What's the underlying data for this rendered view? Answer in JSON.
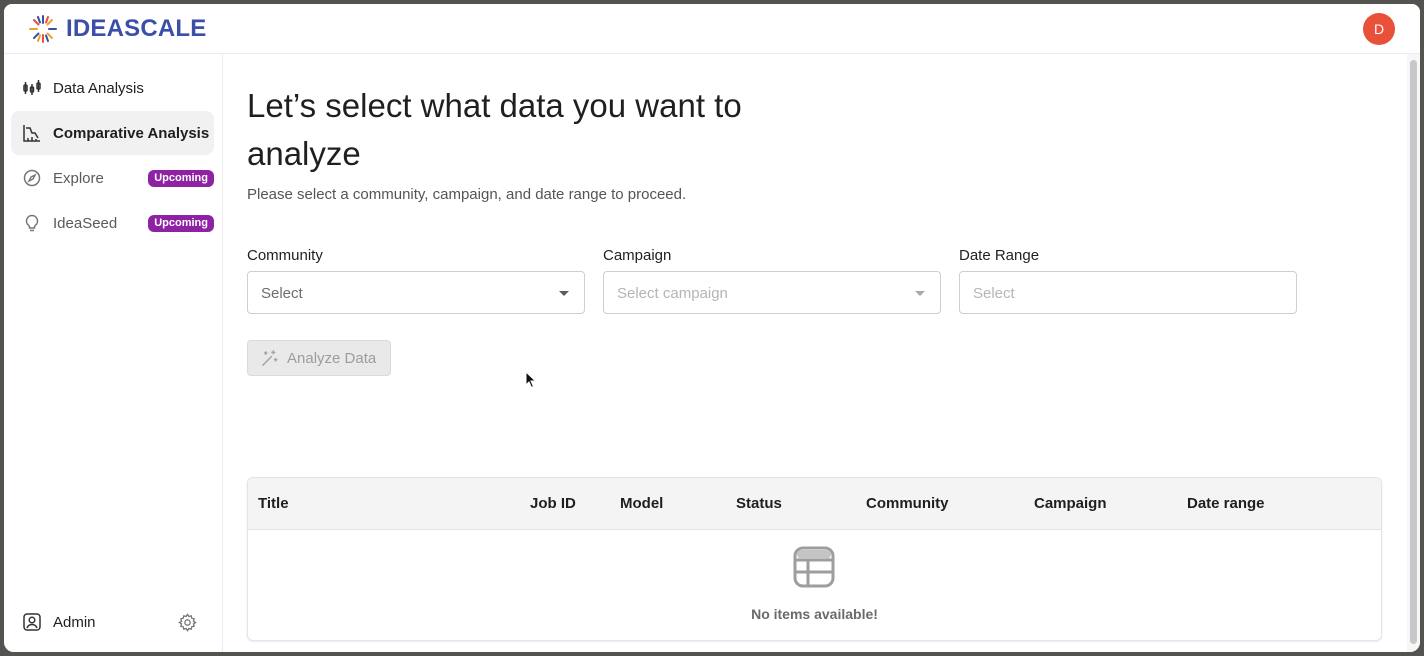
{
  "header": {
    "logo_text": "IDEASCALE",
    "avatar_initial": "D",
    "avatar_color": "#e8503a"
  },
  "sidebar": {
    "items": [
      {
        "label": "Data Analysis",
        "icon": "candlestick-chart-icon",
        "active": false
      },
      {
        "label": "Comparative Analysis",
        "icon": "line-chart-icon",
        "active": true
      },
      {
        "label": "Explore",
        "icon": "compass-icon",
        "badge": "Upcoming"
      },
      {
        "label": "IdeaSeed",
        "icon": "lightbulb-icon",
        "badge": "Upcoming"
      }
    ],
    "footer": {
      "label": "Admin",
      "icon": "user-square-icon",
      "settings_icon": "gear-icon"
    }
  },
  "main": {
    "title": "Let’s select what data you want to analyze",
    "subtitle": "Please select a community, campaign, and date range to proceed.",
    "fields": {
      "community": {
        "label": "Community",
        "placeholder": "Select"
      },
      "campaign": {
        "label": "Campaign",
        "placeholder": "Select campaign"
      },
      "date_range": {
        "label": "Date Range",
        "placeholder": "Select"
      }
    },
    "analyze_button": {
      "label": "Analyze Data",
      "icon": "magic-wand-icon"
    },
    "table": {
      "columns": [
        "Title",
        "Job ID",
        "Model",
        "Status",
        "Community",
        "Campaign",
        "Date range"
      ],
      "empty_text": "No items available!",
      "empty_icon": "table-icon"
    }
  },
  "colors": {
    "brand": "#3b4fa8",
    "badge": "#8e22a3"
  }
}
